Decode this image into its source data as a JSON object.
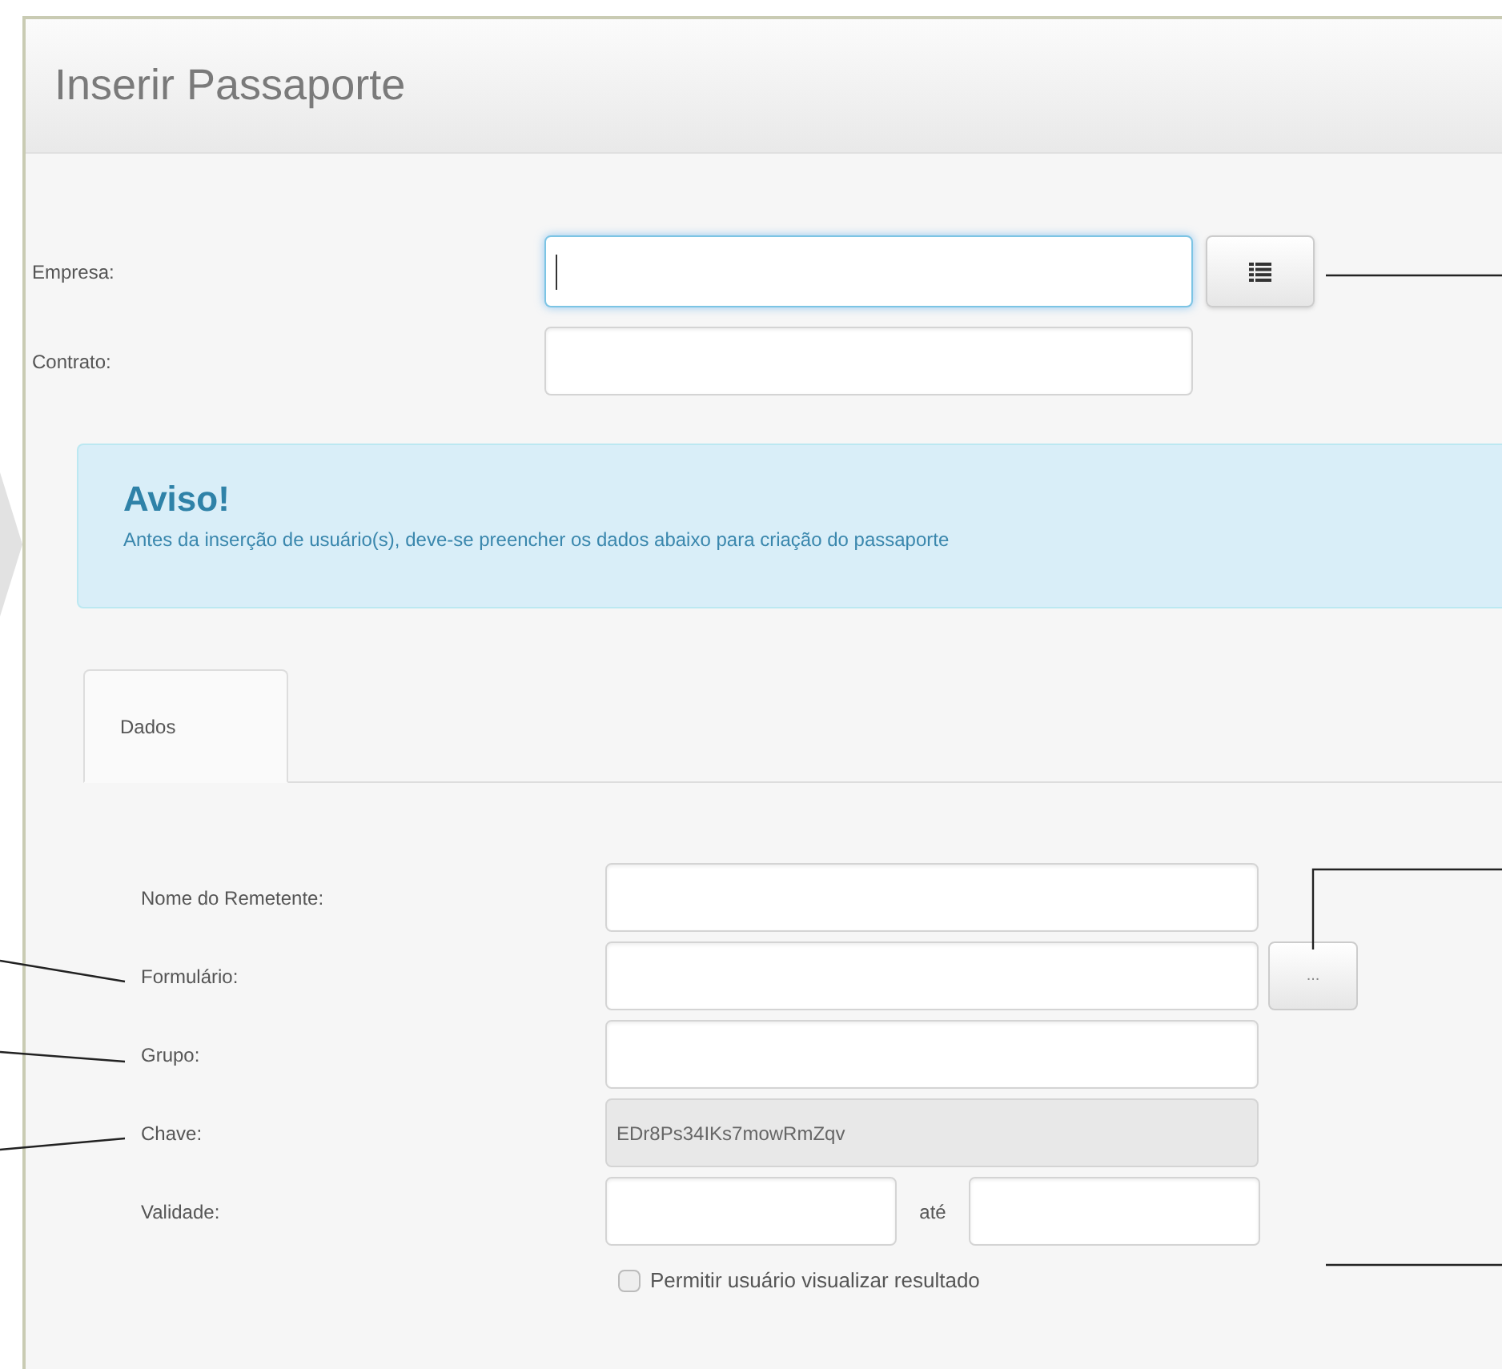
{
  "title": "Inserir Passaporte",
  "top_fields": [
    {
      "label": "Empresa:",
      "focused": true,
      "list_button": true
    },
    {
      "label": "Contrato:",
      "focused": false
    }
  ],
  "alert": {
    "heading": "Aviso!",
    "text": "Antes da inserção de usuário(s), deve-se preencher os dados abaixo para criação do passaporte"
  },
  "tabs": [
    {
      "label": "Dados",
      "selected": true
    }
  ],
  "form": [
    {
      "kind": "text",
      "label": "Nome do Remetente:"
    },
    {
      "kind": "picker",
      "label": "Formulário:",
      "button": "..."
    },
    {
      "kind": "text",
      "label": "Grupo:"
    },
    {
      "kind": "readonly",
      "label": "Chave:",
      "value": "EDr8Ps34IKs7mowRmZqv"
    },
    {
      "kind": "range",
      "label": "Validade:",
      "separator": "até"
    }
  ],
  "checkbox": {
    "label": "Permitir usuário visualizar resultado",
    "checked": false
  }
}
